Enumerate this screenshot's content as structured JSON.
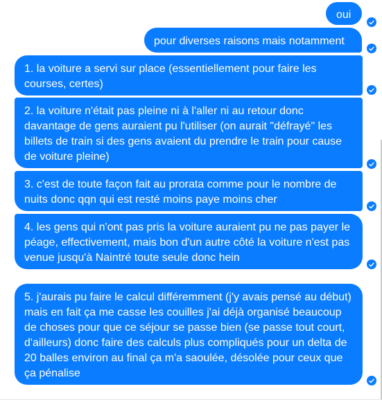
{
  "messages": [
    {
      "text": "oui"
    },
    {
      "text": "pour diverses raisons mais notamment"
    },
    {
      "text": "1. la voiture a servi sur place (essentiellement pour faire les courses, certes)"
    },
    {
      "text": "2. la voiture n'était pas pleine ni à l'aller ni au retour donc davantage de gens auraient pu l'utiliser (on aurait \"défrayé\" les billets de train si des gens avaient du prendre le train pour cause de voiture pleine)"
    },
    {
      "text": "3. c'est de toute façon fait au prorata comme pour le nombre de nuits donc qqn qui est resté moins paye moins cher"
    },
    {
      "text": "4. les gens qui n'ont pas pris la voiture auraient pu ne pas payer le péage, effectivement, mais bon d'un autre côté la voiture n'est pas venue jusqu'à Naintré toute seule donc hein"
    },
    {
      "text": "5. j'aurais pu faire le calcul différemment (j'y avais pensé au début) mais en fait ça me casse les couilles j'ai déjà organisé beaucoup de choses pour que ce séjour se passe bien (se passe tout court, d'ailleurs) donc faire des calculs plus compliqués pour un delta de 20 balles environ au final ça m'a saoulée, désolée pour ceux que ça pénalise"
    }
  ],
  "colors": {
    "bubble": "#0a7cff",
    "text": "#ffffff"
  },
  "icons": {
    "read_receipt": "check-circle-icon"
  }
}
